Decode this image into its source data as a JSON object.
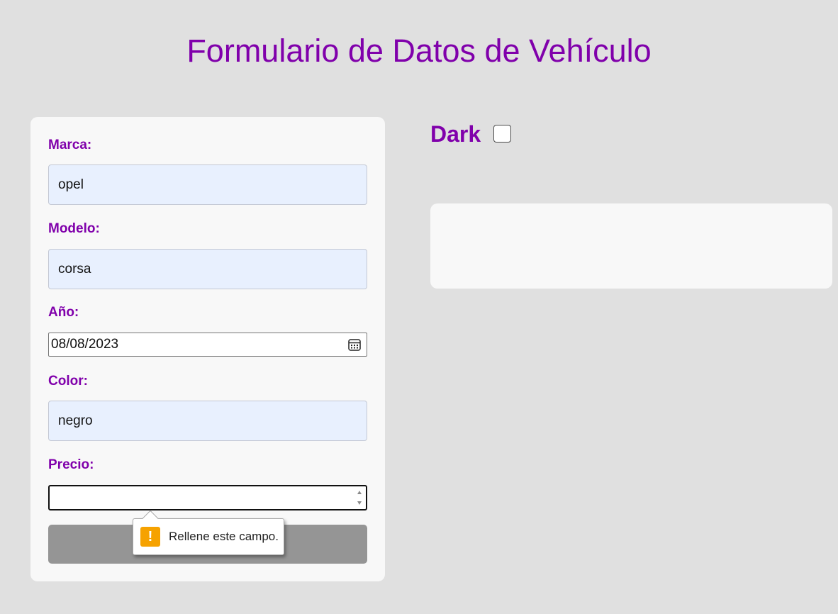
{
  "page": {
    "title": "Formulario de Datos de Vehículo"
  },
  "form": {
    "marca": {
      "label": "Marca:",
      "value": "opel"
    },
    "modelo": {
      "label": "Modelo:",
      "value": "corsa"
    },
    "anio": {
      "label": "Año:",
      "value": "08/08/2023"
    },
    "color": {
      "label": "Color:",
      "value": "negro"
    },
    "precio": {
      "label": "Precio:",
      "value": ""
    },
    "submit": {
      "label": ""
    }
  },
  "validation_tooltip": {
    "icon": "warning-icon",
    "message": "Rellene este campo."
  },
  "theme_toggle": {
    "label": "Dark",
    "checked": false
  },
  "colors": {
    "accent": "#8000ab",
    "background": "#e0e0e0",
    "card": "#f8f8f8",
    "autofill": "#e8f0fe",
    "button": "#959595",
    "warning": "#f6a200"
  }
}
